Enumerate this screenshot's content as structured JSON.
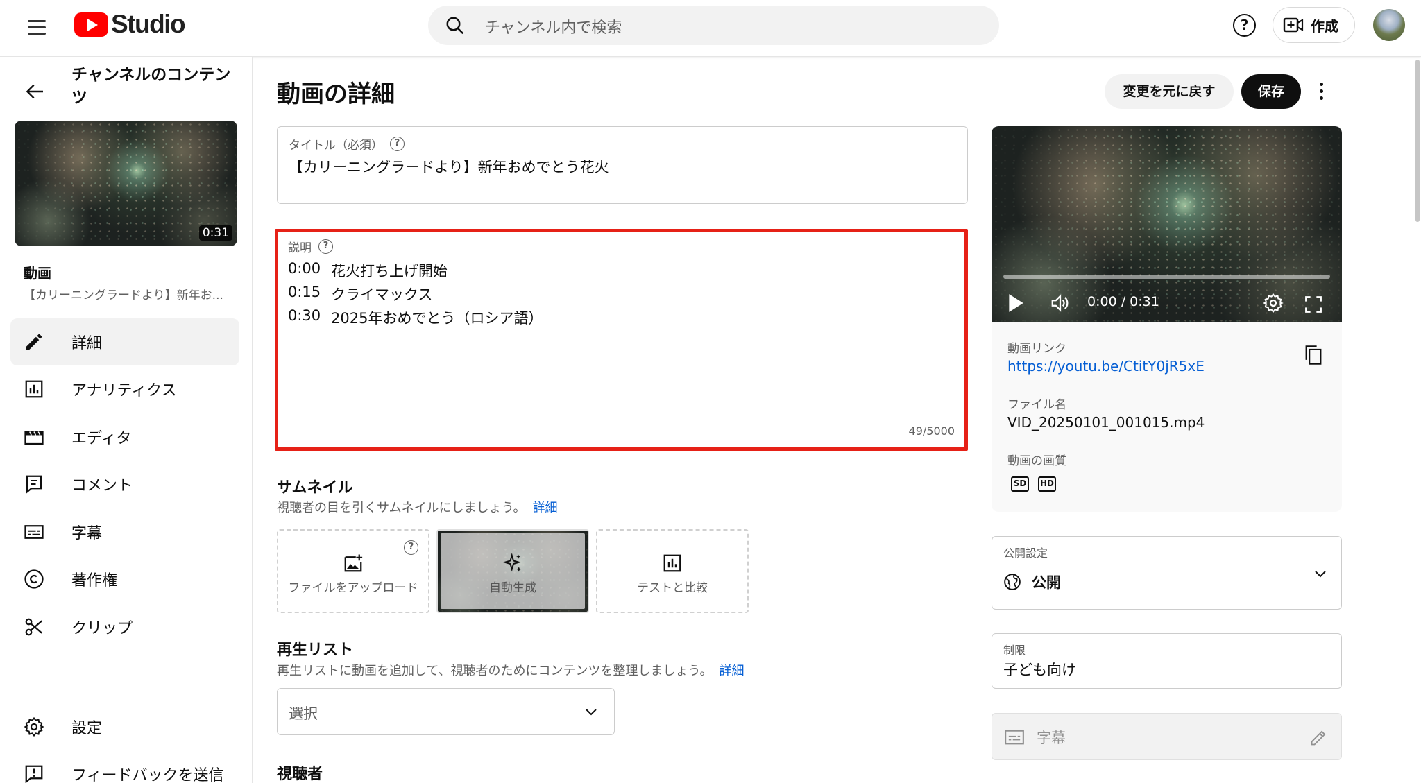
{
  "header": {
    "logo_text": "Studio",
    "search_placeholder": "チャンネル内で検索",
    "help_glyph": "?",
    "create_label": "作成"
  },
  "sidebar": {
    "title": "チャンネルのコンテンツ",
    "thumbnail_duration": "0:31",
    "video_label": "動画",
    "video_subtitle": "【カリーニングラードより】新年お...",
    "items": [
      {
        "label": "詳細",
        "icon": "pencil-icon",
        "active": true
      },
      {
        "label": "アナリティクス",
        "icon": "analytics-icon"
      },
      {
        "label": "エディタ",
        "icon": "editor-icon"
      },
      {
        "label": "コメント",
        "icon": "comment-icon"
      },
      {
        "label": "字幕",
        "icon": "subtitles-icon"
      },
      {
        "label": "著作権",
        "icon": "copyright-icon"
      },
      {
        "label": "クリップ",
        "icon": "scissors-icon"
      }
    ],
    "bottom_items": [
      {
        "label": "設定",
        "icon": "gear-icon"
      },
      {
        "label": "フィードバックを送信",
        "icon": "feedback-icon"
      }
    ]
  },
  "main": {
    "page_title": "動画の詳細",
    "undo_label": "変更を元に戻す",
    "save_label": "保存",
    "title_field": {
      "label": "タイトル（必須）",
      "value": "【カリーニングラードより】新年おめでとう花火"
    },
    "description_field": {
      "label": "説明",
      "lines": [
        {
          "time": "0:00",
          "text": "花火打ち上げ開始"
        },
        {
          "time": "0:15",
          "text": "クライマックス"
        },
        {
          "time": "0:30",
          "text": "2025年おめでとう（ロシア語）"
        }
      ],
      "counter": "49/5000"
    },
    "thumbnail": {
      "title": "サムネイル",
      "subtitle": "視聴者の目を引くサムネイルにしましょう。",
      "link": "詳細",
      "options": [
        {
          "label": "ファイルをアップロード",
          "icon": "upload-image-icon"
        },
        {
          "label": "自動生成",
          "icon": "sparkle-icon"
        },
        {
          "label": "テストと比較",
          "icon": "compare-icon"
        }
      ]
    },
    "playlist": {
      "title": "再生リスト",
      "subtitle": "再生リストに動画を追加して、視聴者のためにコンテンツを整理しましょう。",
      "link": "詳細",
      "select_value": "選択"
    },
    "audience_title": "視聴者"
  },
  "right": {
    "player_time": "0:00 / 0:31",
    "video_link_label": "動画リンク",
    "video_link": "https://youtu.be/CtitY0jR5xE",
    "file_name_label": "ファイル名",
    "file_name": "VID_20250101_001015.mp4",
    "quality_label": "動画の画質",
    "quality_badges": [
      "SD",
      "HD"
    ],
    "visibility": {
      "label": "公開設定",
      "value": "公開"
    },
    "restriction": {
      "label": "制限",
      "value": "子ども向け"
    },
    "captions_label": "字幕"
  },
  "colors": {
    "accent_red": "#e62117",
    "link_blue": "#065fd4",
    "youtube_red": "#ff0000"
  }
}
